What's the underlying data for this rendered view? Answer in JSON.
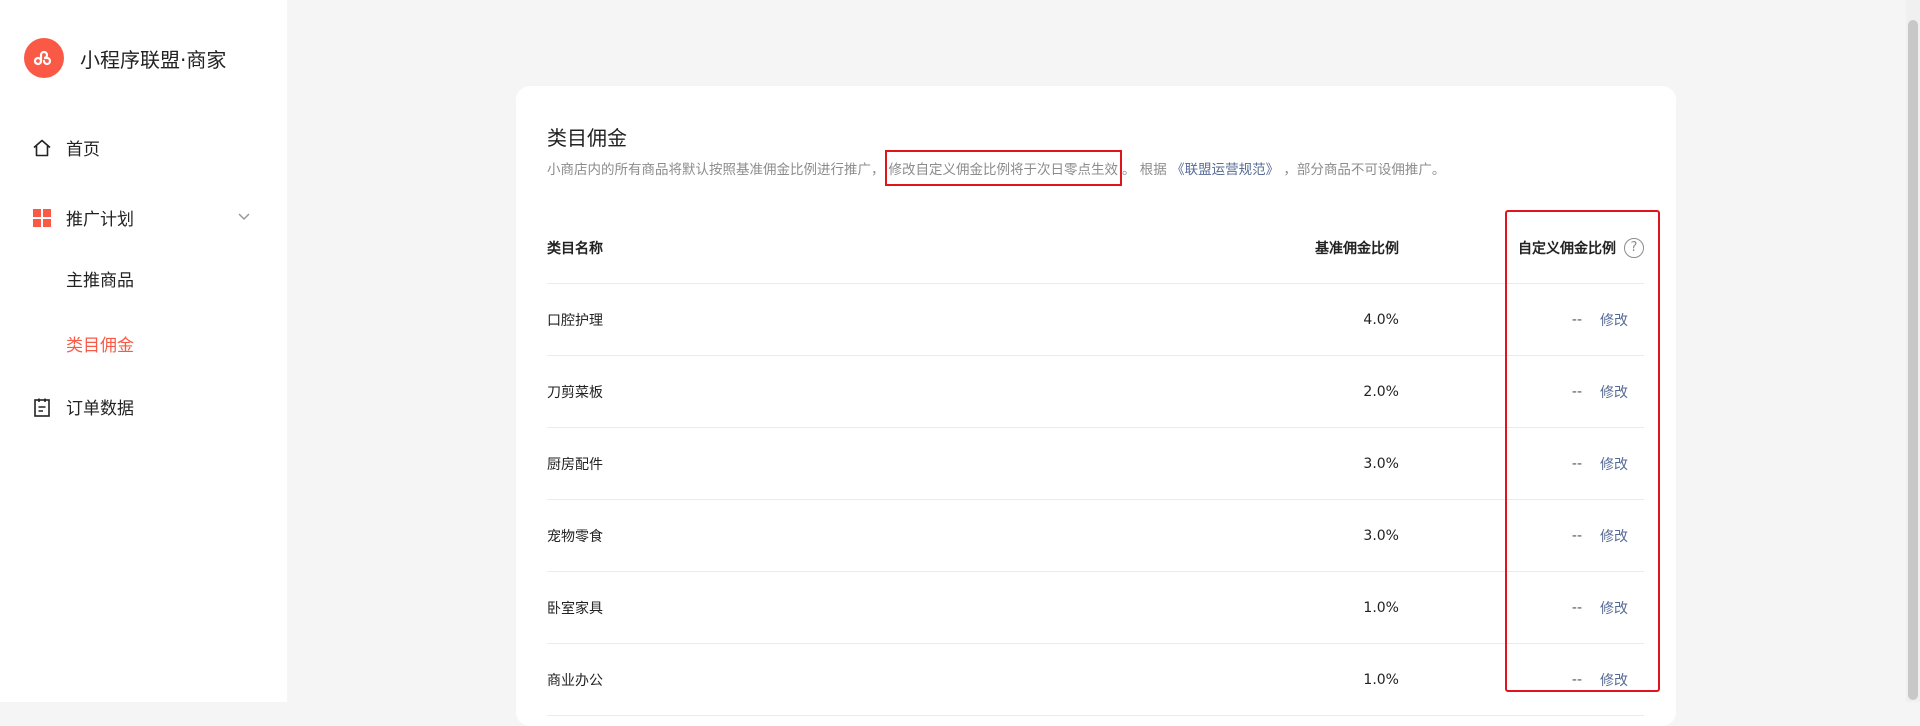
{
  "brand": {
    "name": "小程序联盟·商家"
  },
  "nav": {
    "home": "首页",
    "promotion_plan": "推广计划",
    "featured_products": "主推商品",
    "category_commission": "类目佣金",
    "order_data": "订单数据"
  },
  "colors": {
    "accent": "#fa5a45",
    "link": "#576b95",
    "highlight": "#e0141c"
  },
  "card": {
    "title": "类目佣金",
    "desc_prefix": "小商店内的所有商品将默认按照基准佣金比例进行推广，",
    "desc_highlight": "修改自定义佣金比例将于次日零点生效",
    "desc_mid": "。 根据 ",
    "desc_link": "《联盟运营规范》",
    "desc_suffix": " ，部分商品不可设佣推广。"
  },
  "table": {
    "headers": {
      "name": "类目名称",
      "base": "基准佣金比例",
      "custom": "自定义佣金比例"
    },
    "rows": [
      {
        "name": "口腔护理",
        "base": "4.0%",
        "custom": "--",
        "action": "修改"
      },
      {
        "name": "刀剪菜板",
        "base": "2.0%",
        "custom": "--",
        "action": "修改"
      },
      {
        "name": "厨房配件",
        "base": "3.0%",
        "custom": "--",
        "action": "修改"
      },
      {
        "name": "宠物零食",
        "base": "3.0%",
        "custom": "--",
        "action": "修改"
      },
      {
        "name": "卧室家具",
        "base": "1.0%",
        "custom": "--",
        "action": "修改"
      },
      {
        "name": "商业办公",
        "base": "1.0%",
        "custom": "--",
        "action": "修改"
      }
    ]
  }
}
